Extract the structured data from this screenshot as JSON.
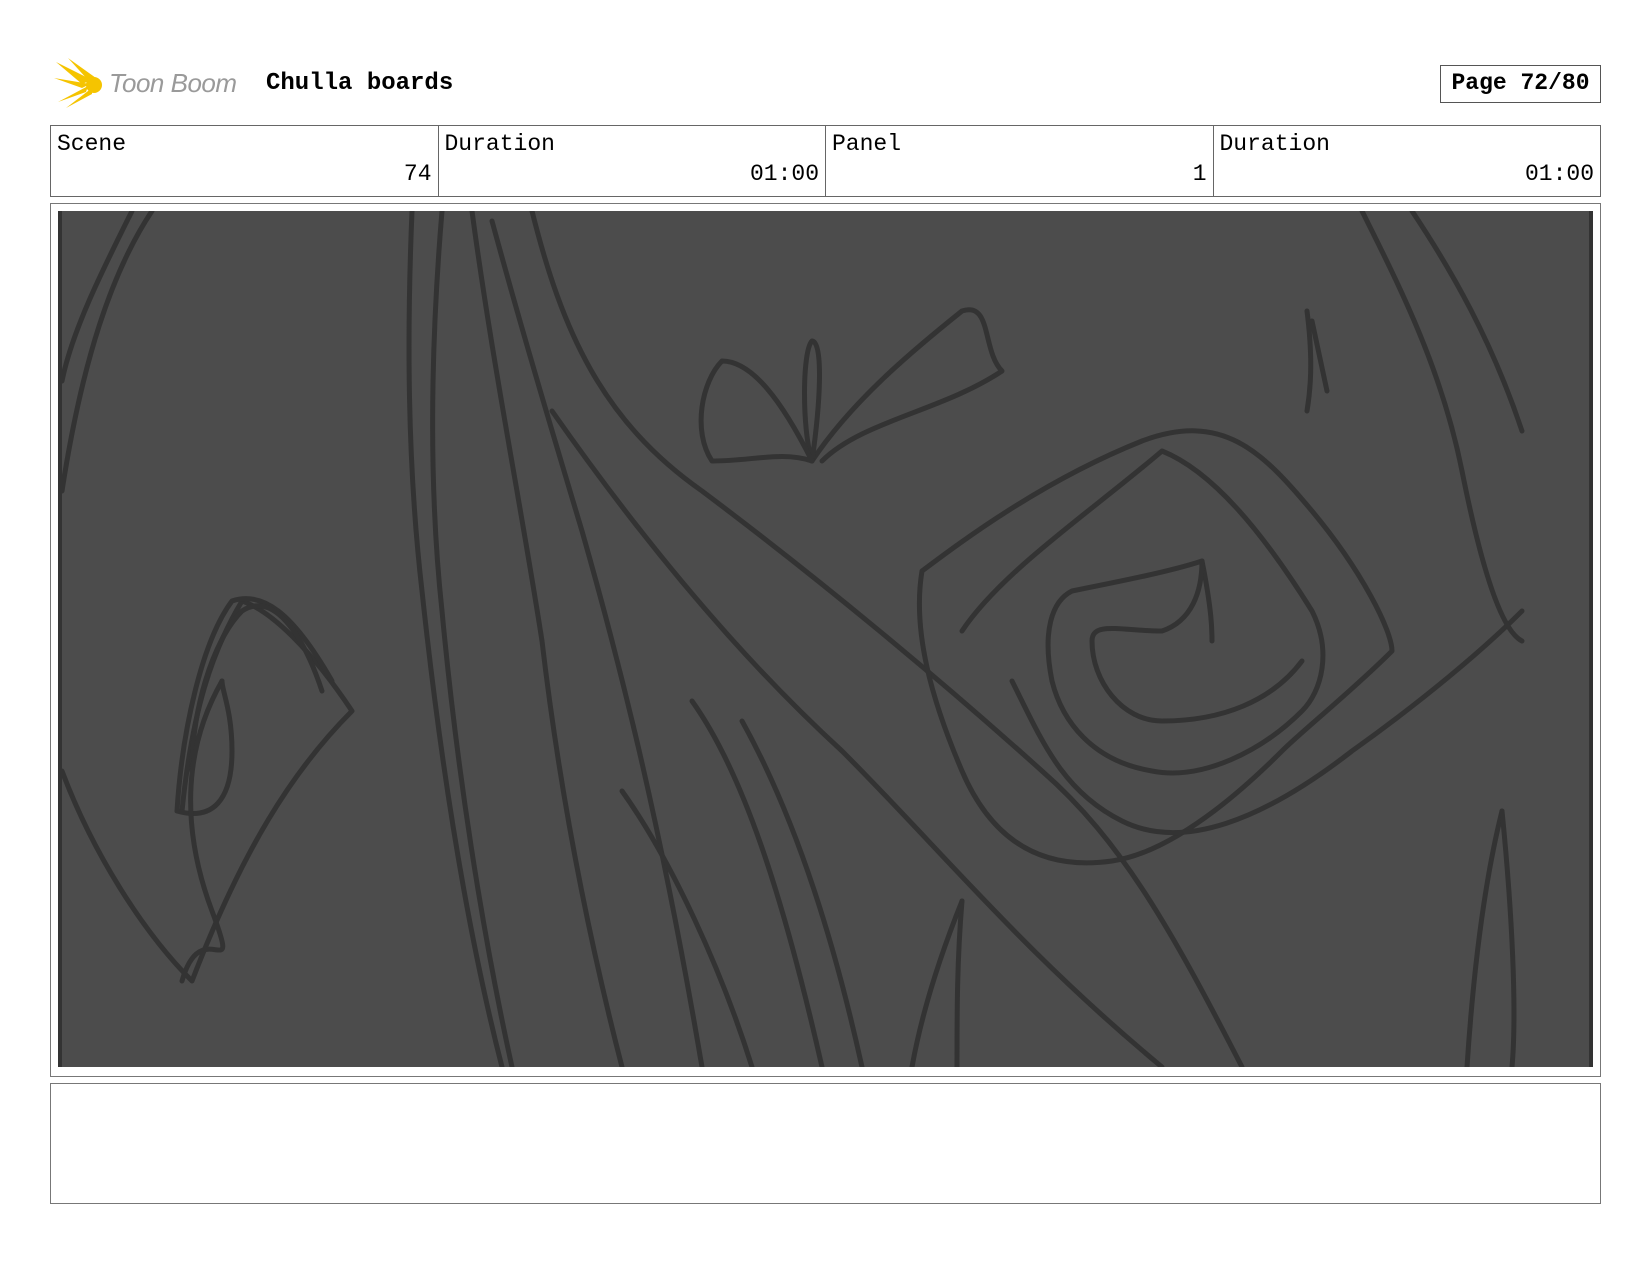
{
  "header": {
    "brand": "Toon Boom",
    "title": "Chulla boards",
    "page_label": "Page 72/80"
  },
  "info": {
    "scene_label": "Scene",
    "scene_value": "74",
    "scene_duration_label": "Duration",
    "scene_duration_value": "01:00",
    "panel_label": "Panel",
    "panel_value": "1",
    "panel_duration_label": "Duration",
    "panel_duration_value": "01:00"
  },
  "notes": {
    "text": ""
  },
  "colors": {
    "logo_accent": "#f5c400",
    "panel_background": "#4c4c4c",
    "sketch_line": "#333333"
  }
}
